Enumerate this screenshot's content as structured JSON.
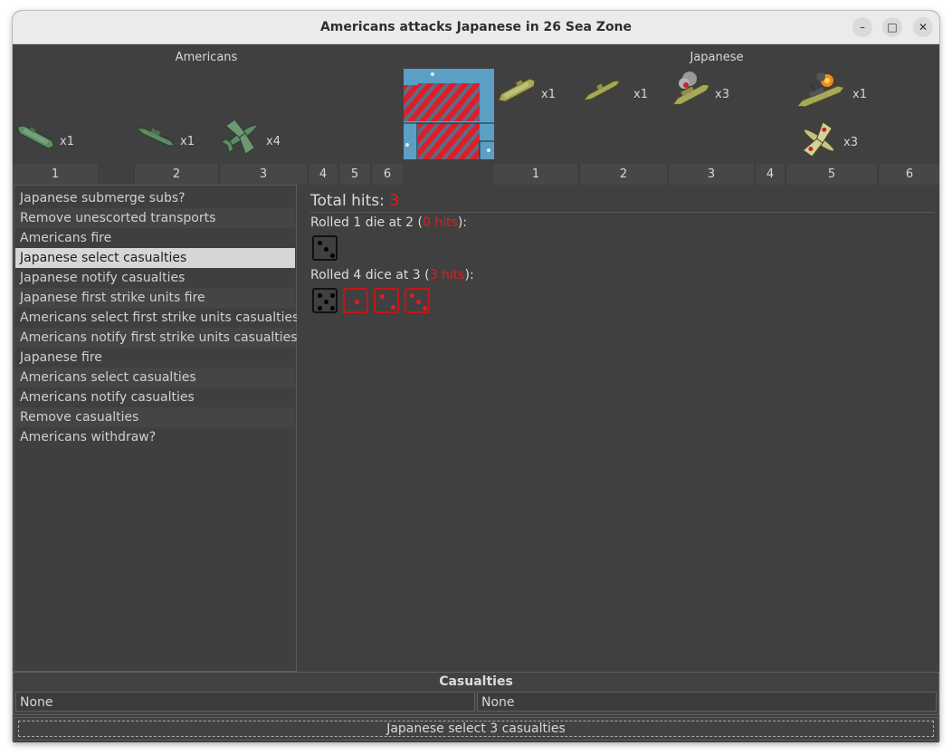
{
  "window": {
    "title": "Americans attacks Japanese in 26 Sea Zone",
    "minimize_icon": "minimize-icon",
    "maximize_icon": "maximize-icon",
    "close_icon": "close-icon"
  },
  "attackers": {
    "label": "Americans",
    "units": [
      {
        "icon": "transport-ship-icon",
        "count": "x1"
      },
      {
        "icon": "battleship-icon",
        "count": "x1"
      },
      {
        "icon": "fighter-plane-icon",
        "count": "x4"
      }
    ],
    "columns": [
      "1",
      "2",
      "3",
      "4",
      "5",
      "6"
    ]
  },
  "defenders": {
    "label": "Japanese",
    "units": [
      {
        "icon": "transport-ship-icon",
        "count": "x1"
      },
      {
        "icon": "submarine-icon",
        "count": "x1"
      },
      {
        "icon": "damaged-ship-icon",
        "count": "x3"
      },
      {
        "icon": "burning-battleship-icon",
        "count": "x1"
      },
      {
        "icon": "fighter-plane-icon",
        "count": "x3"
      }
    ],
    "columns": [
      "1",
      "2",
      "3",
      "4",
      "5",
      "6"
    ]
  },
  "terrain_icon": "sea-zone-terrain-icon",
  "steps": [
    "Japanese submerge subs?",
    "Remove unescorted transports",
    "Americans fire",
    "Japanese select casualties",
    "Japanese notify casualties",
    "Japanese first strike units fire",
    "Americans select first strike units casualties",
    "Americans notify first strike units casualties",
    "Japanese fire",
    "Americans select casualties",
    "Americans notify casualties",
    "Remove casualties",
    "Americans withdraw?"
  ],
  "selected_step": "Japanese select casualties",
  "results": {
    "total_label": "Total hits: ",
    "total_value": "3",
    "rolls": [
      {
        "prefix": "Rolled 1 die at 2 (",
        "hits": "0 hits",
        "suffix": "):",
        "dice": [
          {
            "face": 3,
            "hit": false
          }
        ]
      },
      {
        "prefix": "Rolled 4 dice at 3 (",
        "hits": "3 hits",
        "suffix": "):",
        "dice": [
          {
            "face": 5,
            "hit": false
          },
          {
            "face": 1,
            "hit": true
          },
          {
            "face": 2,
            "hit": true
          },
          {
            "face": 3,
            "hit": true
          }
        ]
      }
    ]
  },
  "casualties": {
    "title": "Casualties",
    "left": "None",
    "right": "None"
  },
  "status": {
    "action_label": "Japanese select 3 casualties"
  },
  "colors": {
    "window_bg": "#404040",
    "hit_red": "#e01e1e",
    "american_unit": "#5e8a64",
    "japanese_unit": "#a6a85a"
  }
}
